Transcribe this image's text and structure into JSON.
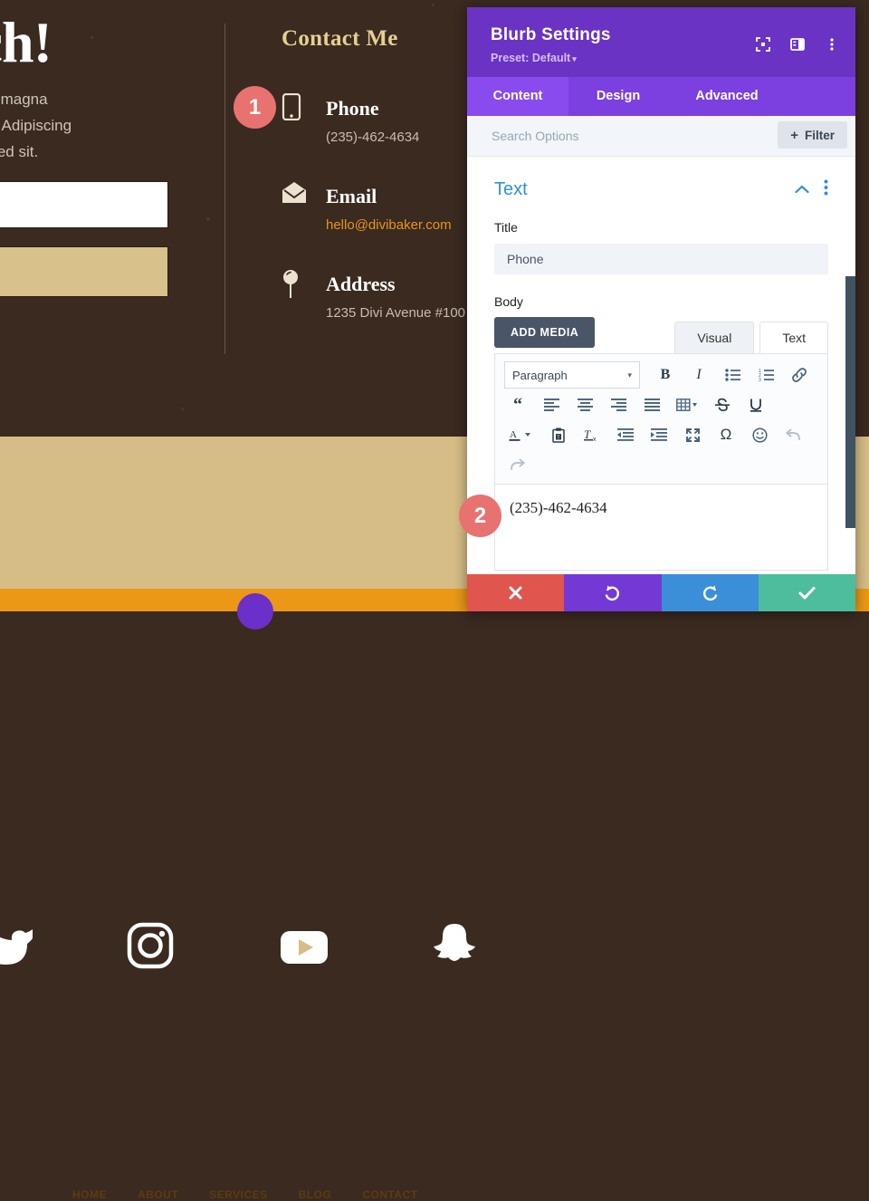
{
  "background_page": {
    "hero": {
      "title": "uch!",
      "paragraph": "vitae id magna\ng nunc. Adipiscing\napien sed sit."
    },
    "contact": {
      "heading": "Contact Me",
      "items": [
        {
          "icon": "mobile-phone-icon",
          "title": "Phone",
          "value": "(235)-462-4634",
          "is_link": false
        },
        {
          "icon": "envelope-icon",
          "title": "Email",
          "value": "hello@divibaker.com",
          "is_link": true
        },
        {
          "icon": "map-pin-icon",
          "title": "Address",
          "value": "1235 Divi Avenue #100",
          "is_link": false
        }
      ]
    },
    "annotations": [
      {
        "number": "1",
        "color": "#e8726f"
      },
      {
        "number": "2",
        "color": "#e8726f"
      }
    ],
    "social_icons": [
      "twitter-icon",
      "instagram-icon",
      "youtube-icon",
      "snapchat-icon"
    ],
    "nav_items": [
      "HOME",
      "ABOUT",
      "SERVICES",
      "BLOG",
      "CONTACT"
    ],
    "colors": {
      "page_bg": "#3a2a20",
      "footer_bg": "#d6bd85",
      "nav_bg": "#eb9816",
      "accent_gold": "#e6cf93",
      "link_orange": "#e8941f"
    }
  },
  "modal": {
    "title": "Blurb Settings",
    "preset": "Preset: Default",
    "preset_caret": "▾",
    "header_icons": [
      "focus-target-icon",
      "panel-layout-icon",
      "more-vertical-icon"
    ],
    "tabs": [
      {
        "label": "Content",
        "active": true
      },
      {
        "label": "Design",
        "active": false
      },
      {
        "label": "Advanced",
        "active": false
      }
    ],
    "search": {
      "placeholder": "Search Options",
      "value": ""
    },
    "filter_button": {
      "plus": "+",
      "label": "Filter"
    },
    "section": {
      "title": "Text",
      "collapse_icon": "chevron-up-icon",
      "menu_icon": "more-vertical-icon"
    },
    "fields": {
      "title_label": "Title",
      "title_value": "Phone",
      "body_label": "Body"
    },
    "editor": {
      "add_media_label": "ADD MEDIA",
      "tabs": [
        {
          "label": "Visual",
          "active": false
        },
        {
          "label": "Text",
          "active": true
        }
      ],
      "format_select": {
        "value": "Paragraph",
        "caret": "▾"
      },
      "toolbar_row1": [
        "bold-icon",
        "italic-icon",
        "bulleted-list-icon",
        "numbered-list-icon",
        "link-icon"
      ],
      "toolbar_row2": [
        "blockquote-icon",
        "align-left-icon",
        "align-center-icon",
        "align-right-icon",
        "align-justify-icon",
        "table-icon",
        "strikethrough-icon",
        "underline-icon"
      ],
      "toolbar_row3": [
        "text-color-icon",
        "paste-as-text-icon",
        "clear-formatting-icon",
        "outdent-icon",
        "indent-icon",
        "fullscreen-icon",
        "special-character-icon",
        "emoji-icon",
        "undo-icon"
      ],
      "toolbar_row4": [
        "redo-icon"
      ],
      "content": "(235)-462-4634"
    },
    "footer_buttons": [
      {
        "name": "cancel",
        "icon": "close-icon",
        "color": "#e0554e"
      },
      {
        "name": "undo",
        "icon": "undo-icon",
        "color": "#7439d4"
      },
      {
        "name": "redo",
        "icon": "redo-icon",
        "color": "#3b8fd8"
      },
      {
        "name": "save",
        "icon": "check-icon",
        "color": "#4dbd9d"
      }
    ],
    "colors": {
      "header_bg": "#6a33c4",
      "tabs_bg": "#7c3fe0",
      "active_tab_bg": "#8a4bee",
      "section_title": "#2e8fe0"
    }
  }
}
